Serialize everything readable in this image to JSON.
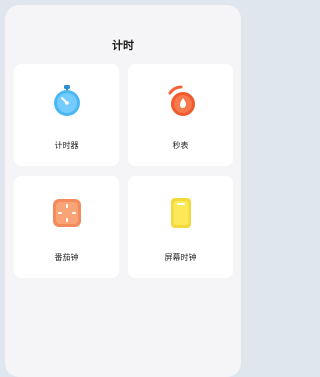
{
  "page": {
    "title": "计时"
  },
  "tools": [
    {
      "label": "计时器",
      "icon": "timer-icon"
    },
    {
      "label": "秒表",
      "icon": "stopwatch-icon"
    },
    {
      "label": "番茄钟",
      "icon": "pomodoro-icon"
    },
    {
      "label": "屏幕时钟",
      "icon": "screen-clock-icon"
    }
  ],
  "colors": {
    "timer": "#41b6f3",
    "stopwatch": "#f4633a",
    "pomodoro": "#f59468",
    "screen_clock": "#f8e23c",
    "background": "#f5f5f7",
    "tile": "#ffffff"
  }
}
